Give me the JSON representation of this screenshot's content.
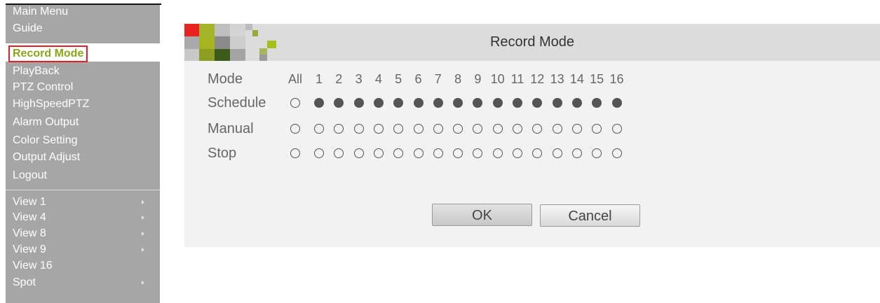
{
  "menu": {
    "title": "Main Menu",
    "selected": "Record Mode",
    "items": [
      {
        "label": "Guide"
      },
      {
        "label": "Record Mode"
      },
      {
        "label": "PlayBack"
      },
      {
        "label": "PTZ Control"
      },
      {
        "label": "HighSpeedPTZ"
      },
      {
        "label": "Alarm Output"
      },
      {
        "label": "Color Setting"
      },
      {
        "label": "Output Adjust"
      },
      {
        "label": "Logout"
      }
    ],
    "views": [
      {
        "label": "View 1",
        "submenu": true
      },
      {
        "label": "View 4",
        "submenu": true
      },
      {
        "label": "View 8",
        "submenu": true
      },
      {
        "label": "View 9",
        "submenu": true
      },
      {
        "label": "View 16",
        "submenu": false
      },
      {
        "label": "Spot",
        "submenu": true
      }
    ]
  },
  "window": {
    "title": "Record Mode",
    "mode_header": "Mode",
    "all_header": "All",
    "channels": [
      "1",
      "2",
      "3",
      "4",
      "5",
      "6",
      "7",
      "8",
      "9",
      "10",
      "11",
      "12",
      "13",
      "14",
      "15",
      "16"
    ],
    "rows": [
      {
        "label": "Schedule",
        "all": false,
        "channels": [
          true,
          true,
          true,
          true,
          true,
          true,
          true,
          true,
          true,
          true,
          true,
          true,
          true,
          true,
          true,
          true
        ]
      },
      {
        "label": "Manual",
        "all": false,
        "channels": [
          false,
          false,
          false,
          false,
          false,
          false,
          false,
          false,
          false,
          false,
          false,
          false,
          false,
          false,
          false,
          false
        ]
      },
      {
        "label": "Stop",
        "all": false,
        "channels": [
          false,
          false,
          false,
          false,
          false,
          false,
          false,
          false,
          false,
          false,
          false,
          false,
          false,
          false,
          false,
          false
        ]
      }
    ],
    "ok_label": "OK",
    "cancel_label": "Cancel"
  },
  "colors": {
    "menu_bg": "#a6a6a6",
    "highlight_border": "#e0202c",
    "highlight_text": "#8ba41c",
    "title_bar": "#dcdcdc",
    "window_bg": "#f2f2f2"
  }
}
